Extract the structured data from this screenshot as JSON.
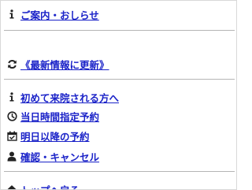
{
  "menu": {
    "info": {
      "label": "ご案内・おしらせ",
      "icon": "info-icon"
    },
    "refresh": {
      "label": "《最新情報に更新》",
      "icon": "refresh-icon"
    },
    "first_visit": {
      "label": "初めて来院される方へ",
      "icon": "info-icon"
    },
    "today": {
      "label": "当日時間指定予約",
      "icon": "clock-icon"
    },
    "tomorrow": {
      "label": "明日以降の予約",
      "icon": "calendar-check-icon"
    },
    "confirm": {
      "label": "確認・キャンセル",
      "icon": "user-icon"
    },
    "top": {
      "label": "トップへ戻る",
      "icon": "home-icon"
    }
  },
  "colors": {
    "link": "#1a22c8",
    "icon": "#222222",
    "rule": "#b5b5b5"
  }
}
